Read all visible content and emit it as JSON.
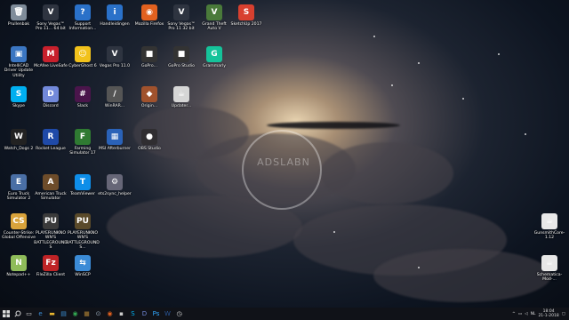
{
  "desktop": {
    "watermark_text": "ADSLABN",
    "icons": [
      {
        "label": "Prullenbak",
        "symbol": "🗑",
        "color": "#7f8c9a"
      },
      {
        "label": "Sony Vegas™ Pro 11... 64 bit",
        "symbol": "V",
        "color": "#2e3440"
      },
      {
        "label": "Support Information...",
        "symbol": "?",
        "color": "#2a71c9"
      },
      {
        "label": "Handleidingen",
        "symbol": "i",
        "color": "#2a71c9"
      },
      {
        "label": "Mozilla Firefox",
        "symbol": "◉",
        "color": "#e2611f"
      },
      {
        "label": "Sony Vegas™ Pro 11 32 bit",
        "symbol": "V",
        "color": "#2e3440"
      },
      {
        "label": "Grand Theft Auto V",
        "symbol": "V",
        "color": "#4a7a3a"
      },
      {
        "label": "SketchUp 2017",
        "symbol": "S",
        "color": "#d8402f"
      },
      {
        "label": "IntelliCAD Driver Update Utility",
        "symbol": "▣",
        "color": "#3b76c2"
      },
      {
        "label": "McAfee LiveSafe",
        "symbol": "M",
        "color": "#c8202c"
      },
      {
        "label": "CyberGhost 6",
        "symbol": "☺",
        "color": "#f2c21b"
      },
      {
        "label": "Vegas Pro 11.0",
        "symbol": "V",
        "color": "#2e3440"
      },
      {
        "label": "GoPro...",
        "symbol": "■",
        "color": "#333"
      },
      {
        "label": "GoPro Studio",
        "symbol": "■",
        "color": "#333"
      },
      {
        "label": "Grammarly",
        "symbol": "G",
        "color": "#15c39a"
      },
      {
        "label": "Skype",
        "symbol": "S",
        "color": "#00aff0"
      },
      {
        "label": "Discord",
        "symbol": "D",
        "color": "#7289da"
      },
      {
        "label": "Slack",
        "symbol": "#",
        "color": "#4a154b"
      },
      {
        "label": "WinRAR...",
        "symbol": "/",
        "color": "#555"
      },
      {
        "label": "Origin...",
        "symbol": "◆",
        "color": "#a0522d"
      },
      {
        "label": "Updater...",
        "symbol": "☕",
        "color": "#d6d6d6"
      },
      {
        "label": "Watch_Dogs 2",
        "symbol": "W",
        "color": "#222"
      },
      {
        "label": "Rocket League",
        "symbol": "R",
        "color": "#1f4aa8"
      },
      {
        "label": "Farming Simulator 17",
        "symbol": "F",
        "color": "#2f7a32"
      },
      {
        "label": "MSI Afterburner",
        "symbol": "▦",
        "color": "#2a62b8"
      },
      {
        "label": "OBS Studio",
        "symbol": "●",
        "color": "#302e31"
      },
      {
        "label": "Euro Truck Simulator 2",
        "symbol": "E",
        "color": "#4a6fa5"
      },
      {
        "label": "American Truck Simulator",
        "symbol": "A",
        "color": "#6d4c2a"
      },
      {
        "label": "TeamViewer",
        "symbol": "T",
        "color": "#0e8ee9"
      },
      {
        "label": "ets2sync_helper",
        "symbol": "⚙",
        "color": "#667"
      },
      {
        "label": "Counter-Strike: Global Offensive",
        "symbol": "CS",
        "color": "#d9a33b"
      },
      {
        "label": "PLAYERUNKNOWN'S BATTLEGROUNDS",
        "symbol": "PU",
        "color": "#3b3b3b"
      },
      {
        "label": "PLAYERUNKNOWN'S BATTLEGROUNDS...",
        "symbol": "PU",
        "color": "#5a4a2a"
      },
      {
        "label": "Notepad++",
        "symbol": "N",
        "color": "#8fbc5a"
      },
      {
        "label": "FileZilla Client",
        "symbol": "Fz",
        "color": "#bf2326"
      },
      {
        "label": "WinSCP",
        "symbol": "⇆",
        "color": "#3b8bd6"
      },
      {
        "label": "GunsmithCore-1.12",
        "symbol": "☕",
        "color": "#e8e8e8"
      },
      {
        "label": "Schematica-Mod-...",
        "symbol": "☕",
        "color": "#e8e8e8"
      }
    ]
  },
  "taskbar": {
    "start_icon": "windows-start-icon",
    "search_icon": "search-icon",
    "pinned": [
      {
        "name": "task-view-icon",
        "symbol": "▭",
        "color": "#ddd"
      },
      {
        "name": "edge-icon",
        "symbol": "e",
        "color": "#3c8fd6"
      },
      {
        "name": "file-explorer-icon",
        "symbol": "▬",
        "color": "#e8b630"
      },
      {
        "name": "store-icon",
        "symbol": "▤",
        "color": "#3c8fd6"
      },
      {
        "name": "chrome-icon",
        "symbol": "◉",
        "color": "#34a853"
      },
      {
        "name": "minecraft-icon",
        "symbol": "■",
        "color": "#7a5c2a"
      },
      {
        "name": "steam-icon",
        "symbol": "⊙",
        "color": "#9ab"
      },
      {
        "name": "firefox-icon",
        "symbol": "◉",
        "color": "#e2611f"
      },
      {
        "name": "cmd-icon",
        "symbol": "▪",
        "color": "#ccc"
      },
      {
        "name": "skype-icon",
        "symbol": "S",
        "color": "#00aff0"
      },
      {
        "name": "discord-icon",
        "symbol": "D",
        "color": "#7289da"
      },
      {
        "name": "photoshop-icon",
        "symbol": "Ps",
        "color": "#31a8ff"
      },
      {
        "name": "word-icon",
        "symbol": "W",
        "color": "#2b579a"
      },
      {
        "name": "clock-app-icon",
        "symbol": "◷",
        "color": "#ddd"
      }
    ],
    "tray": {
      "chevron": "^",
      "language": "NL",
      "time": "18:04",
      "date": "21-1-2018"
    }
  }
}
